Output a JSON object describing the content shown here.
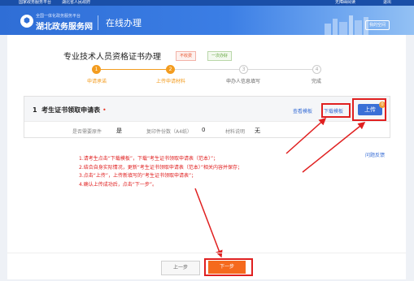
{
  "topbar": {
    "left_links": [
      "国家政务服务平台",
      "湖北省人民政府"
    ],
    "right_links": [
      "无障碍阅读",
      "退出"
    ]
  },
  "header": {
    "logo_subtitle": "全国一体化政务服务平台",
    "logo_title": "湖北政务服务网",
    "section_title": "在线办理",
    "user_button": "我的空间"
  },
  "item": {
    "title": "专业技术人员资格证书办理",
    "tags": [
      "不收费",
      "一次办好"
    ]
  },
  "steps": [
    {
      "number": "1",
      "label": "申请承诺",
      "state": "done"
    },
    {
      "number": "2",
      "label": "上传申请材料",
      "state": "current"
    },
    {
      "number": "3",
      "label": "申办人信息填写",
      "state": "todo"
    },
    {
      "number": "4",
      "label": "完成",
      "state": "todo"
    }
  ],
  "material": {
    "index": "1",
    "title": "考生证书领取申请表",
    "required_mark": "•",
    "view_template": "查看模板",
    "download_template": "下载模板",
    "upload_button": "上传",
    "upload_count": "0",
    "meta": [
      {
        "label": "是否需要原件",
        "value": "是"
      },
      {
        "label": "复印件份数（A4纸）",
        "value": "0"
      },
      {
        "label": "材料说明",
        "value": "无"
      }
    ]
  },
  "feedback_link": "问题反馈",
  "annotations": [
    "1.请考生点击“下载模板”，下载“考生证书领取申请表（范本）”；",
    "2.结合自身实际情况，更新“考生证书领取申请表（范本）”相关内容并保存；",
    "3.点击“上传”，上传新填写的“考生证书领取申请表”；",
    "4.确认上传成功后，点击“下一步”。"
  ],
  "footer": {
    "prev_button": "上一步",
    "next_button": "下一步"
  },
  "colors": {
    "accent_blue": "#3a6fd6",
    "header_blue": "#2f6ed6",
    "step_orange": "#f39c1f",
    "next_orange": "#f56a1d",
    "annotation_red": "#e02020"
  }
}
